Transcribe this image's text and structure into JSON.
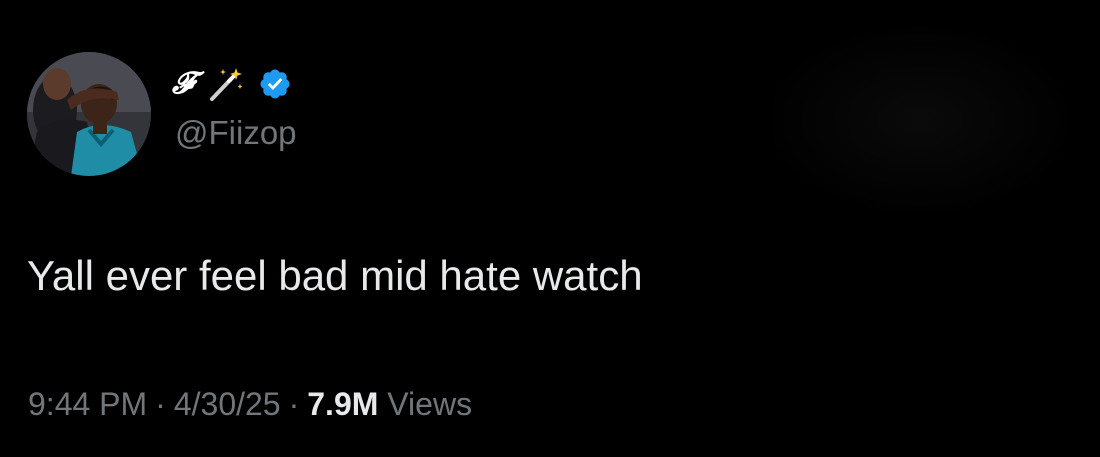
{
  "tweet": {
    "author": {
      "display_name": "𝓕",
      "name_emoji_icon": "magic-wand-icon",
      "verified_icon": "verified-badge-icon",
      "handle": "@Fiizop",
      "avatar_icon": "profile-photo"
    },
    "text": "Yall ever feel bad mid hate watch",
    "meta": {
      "time": "9:44 PM",
      "separator": "·",
      "date": "4/30/25",
      "views_count": "7.9M",
      "views_label": "Views"
    },
    "colors": {
      "background": "#000000",
      "primary_text": "#e7e9ea",
      "secondary_text": "#71767b",
      "verified_blue": "#1d9bf0"
    }
  }
}
